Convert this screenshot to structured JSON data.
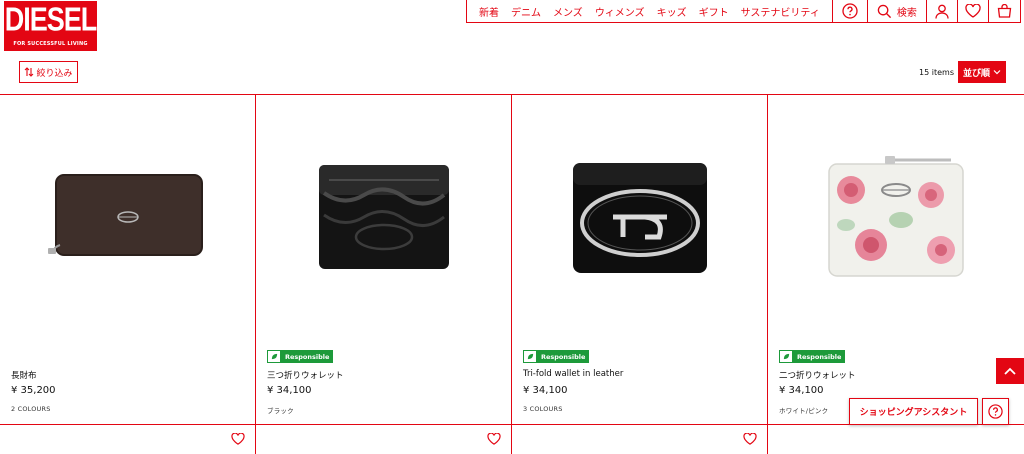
{
  "brand": {
    "name": "DIESEL",
    "tagline": "FOR SUCCESSFUL LIVING",
    "color": "#e30613"
  },
  "nav": {
    "links": [
      "新着",
      "デニム",
      "メンズ",
      "ウィメンズ",
      "キッズ",
      "ギフト",
      "サステナビリティ"
    ],
    "search_label": "検索",
    "icons": [
      "help-icon",
      "search-icon",
      "account-icon",
      "wishlist-icon",
      "cart-icon"
    ]
  },
  "toolbar": {
    "filter_label": "絞り込み",
    "count": "15 items",
    "sort_label": "並び順"
  },
  "products": [
    {
      "name": "長財布",
      "price": "¥ 35,200",
      "meta": "2 COLOURS",
      "responsible": false,
      "image": "brown-long-wallet"
    },
    {
      "name": "三つ折りウォレット",
      "price": "¥ 34,100",
      "meta": "ブラック",
      "responsible": true,
      "image": "black-trifold-wallet-embossed"
    },
    {
      "name": "Tri-fold wallet in leather",
      "price": "¥ 34,100",
      "meta": "3 COLOURS",
      "responsible": true,
      "image": "black-trifold-wallet-oval-d"
    },
    {
      "name": "二つ折りウォレット",
      "price": "¥ 34,100",
      "meta": "ホワイト/ピンク",
      "responsible": true,
      "image": "floral-bifold-wallet"
    }
  ],
  "badge_label": "Responsible",
  "assistant": {
    "label": "ショッピングアシスタント"
  },
  "colors": {
    "accent": "#e30613",
    "responsible_green": "#1d9a3a"
  }
}
